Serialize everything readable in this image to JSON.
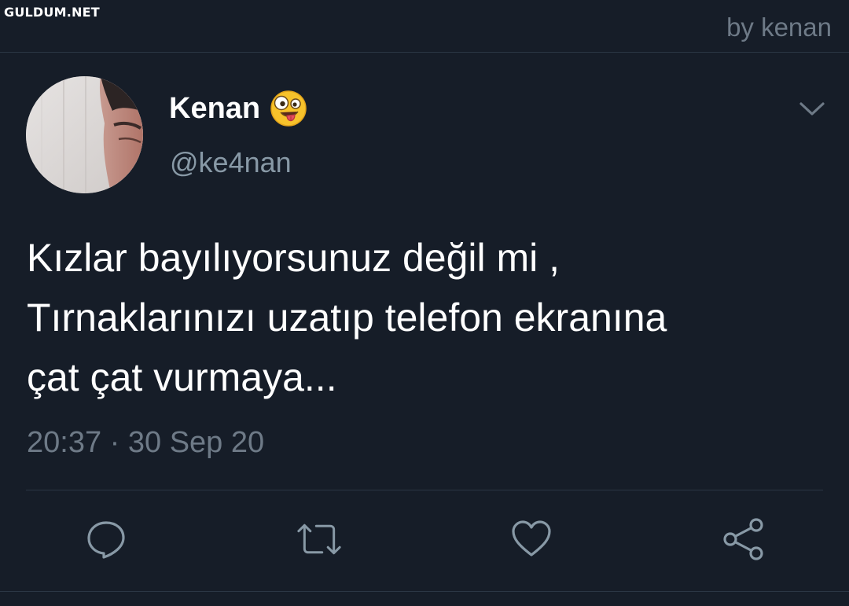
{
  "watermark": "GULDUM.NET",
  "byline": "by kenan",
  "tweet": {
    "display_name": "Kenan",
    "emoji_icon": "zany-face-emoji",
    "handle": "@ke4nan",
    "text_lines": [
      "Kızlar bayılıyorsunuz değil mi ,",
      "Tırnaklarınızı uzatıp telefon ekranına",
      "çat çat vurmaya..."
    ],
    "timestamp": "20:37 · 30 Sep 20"
  },
  "actions": [
    "reply-icon",
    "retweet-icon",
    "like-icon",
    "share-icon"
  ],
  "colors": {
    "background": "#161d28",
    "secondary_text": "#8899a6",
    "divider": "#2b3644",
    "primary_text": "#ffffff"
  }
}
